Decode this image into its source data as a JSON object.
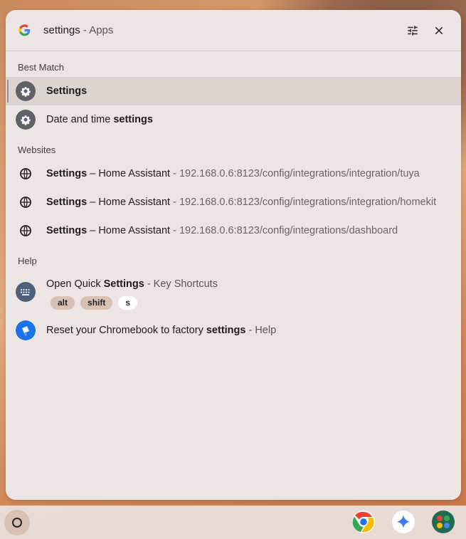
{
  "search": {
    "query": "settings",
    "category": " - Apps"
  },
  "sections": {
    "best_match": "Best Match",
    "websites": "Websites",
    "help": "Help"
  },
  "results": {
    "settings_app": {
      "label": "Settings"
    },
    "date_time": {
      "prefix": "Date and time ",
      "match": "settings"
    },
    "web1": {
      "title": "Settings",
      "sep": " – Home Assistant",
      "dash": " - ",
      "url": "192.168.0.6:8123/config/integrations/integration/tuya"
    },
    "web2": {
      "title": "Settings",
      "sep": " – Home Assistant",
      "dash": " - ",
      "url": "192.168.0.6:8123/config/integrations/integration/homekit"
    },
    "web3": {
      "title": "Settings",
      "sep": " – Home Assistant",
      "dash": " - ",
      "url": "192.168.0.6:8123/config/integrations/dashboard"
    },
    "quick_settings": {
      "prefix": "Open Quick ",
      "match": "Settings",
      "suffix": " - Key Shortcuts",
      "keys": [
        "alt",
        "shift",
        "s"
      ]
    },
    "reset": {
      "prefix": "Reset your Chromebook to factory ",
      "match": "settings",
      "suffix": " - Help"
    }
  },
  "colors": {
    "accent_blue": "#1a73e8",
    "settings_icon_bg": "#5f6368"
  },
  "icons": {
    "search_provider": "google-g-icon",
    "tune": "tune-icon",
    "close": "close-icon",
    "gear": "gear-icon",
    "globe": "globe-icon",
    "keyboard": "keyboard-icon",
    "tips": "tips-icon",
    "chrome": "chrome-icon",
    "gemini": "gemini-icon",
    "apps": "apps-icon"
  }
}
